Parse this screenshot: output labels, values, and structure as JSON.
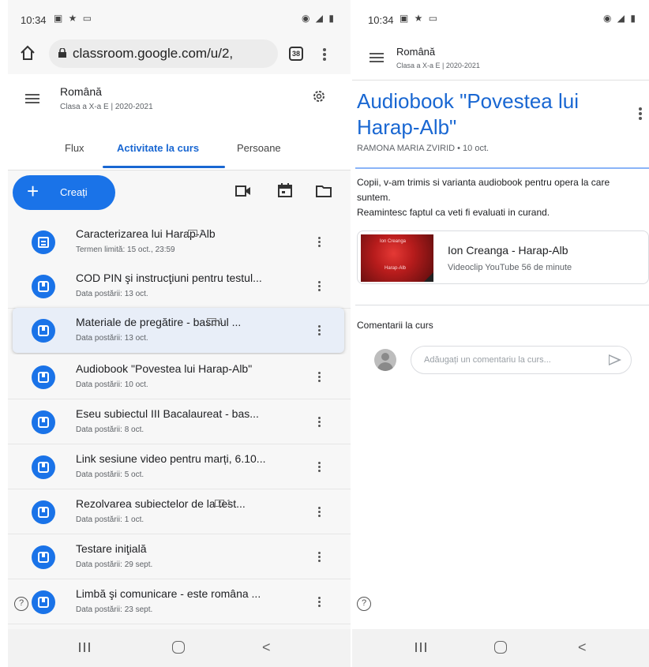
{
  "left": {
    "status": {
      "time": "10:34",
      "left_icons": "▣ ★ ▭",
      "right_icons": "◉ ◢ ▮"
    },
    "browser": {
      "url": "classroom.google.com/u/2,",
      "tab_count": "38"
    },
    "course": {
      "title": "Română",
      "subtitle": "Clasa a X-a E | 2020-2021"
    },
    "tabs": [
      {
        "label": "Flux"
      },
      {
        "label": "Activitate la curs"
      },
      {
        "label": "Persoane"
      }
    ],
    "create": {
      "plus": "+",
      "label": "Creați"
    },
    "items": [
      {
        "title": "Caracterizarea lui Harap-Alb",
        "date": "Termen limită: 15 oct., 23:59",
        "comments": "1",
        "kind": "assignment"
      },
      {
        "title": "COD PIN şi instrucţiuni pentru testul...",
        "date": "Data postării: 13 oct.",
        "comments": "",
        "kind": "material"
      },
      {
        "title": "Materiale de pregătire - basmul ...",
        "date": "Data postării: 13 oct.",
        "comments": "1",
        "kind": "material"
      },
      {
        "title": "Audiobook \"Povestea lui Harap-Alb\"",
        "date": "Data postării: 10 oct.",
        "comments": "",
        "kind": "material"
      },
      {
        "title": "Eseu subiectul III Bacalaureat - bas...",
        "date": "Data postării: 8 oct.",
        "comments": "",
        "kind": "material"
      },
      {
        "title": "Link sesiune video pentru marți, 6.10...",
        "date": "Data postării: 5 oct.",
        "comments": "",
        "kind": "material"
      },
      {
        "title": "Rezolvarea subiectelor de la test...",
        "date": "Data postării: 1 oct.",
        "comments": "1",
        "kind": "material"
      },
      {
        "title": "Testare iniţială",
        "date": "Data postării: 29 sept.",
        "comments": "",
        "kind": "material"
      },
      {
        "title": "Limbă şi comunicare - este româna ...",
        "date": "Data postării: 23 sept.",
        "comments": "",
        "kind": "material"
      }
    ],
    "help": "?"
  },
  "right": {
    "status": {
      "time": "10:34",
      "left_icons": "▣ ★ ▭",
      "right_icons": "◉ ◢ ▮"
    },
    "course": {
      "title": "Română",
      "subtitle": "Clasa a X-a E | 2020-2021"
    },
    "post": {
      "title": "Audiobook \"Povestea lui Harap-Alb\"",
      "meta": "RAMONA MARIA ZVIRID • 10 oct.",
      "description_1": "Copii, v-am trimis si varianta audiobook pentru opera la care suntem.",
      "description_2": "Reamintesc faptul ca veti fi evaluati in curand."
    },
    "attachment": {
      "title": "Ion Creanga - Harap-Alb",
      "subtitle": "Videoclip YouTube   56 de minute",
      "thumb_text_top": "Ion Creanga",
      "thumb_text_bottom": "Harap-Alb"
    },
    "comments": {
      "label": "Comentarii la curs",
      "placeholder": "Adăugați un comentariu la curs..."
    },
    "help": "?"
  },
  "nav": {
    "back": "<"
  },
  "colors": {
    "accent": "#1a73e8",
    "title_blue": "#1967d2",
    "highlight": "#e8eef8"
  }
}
